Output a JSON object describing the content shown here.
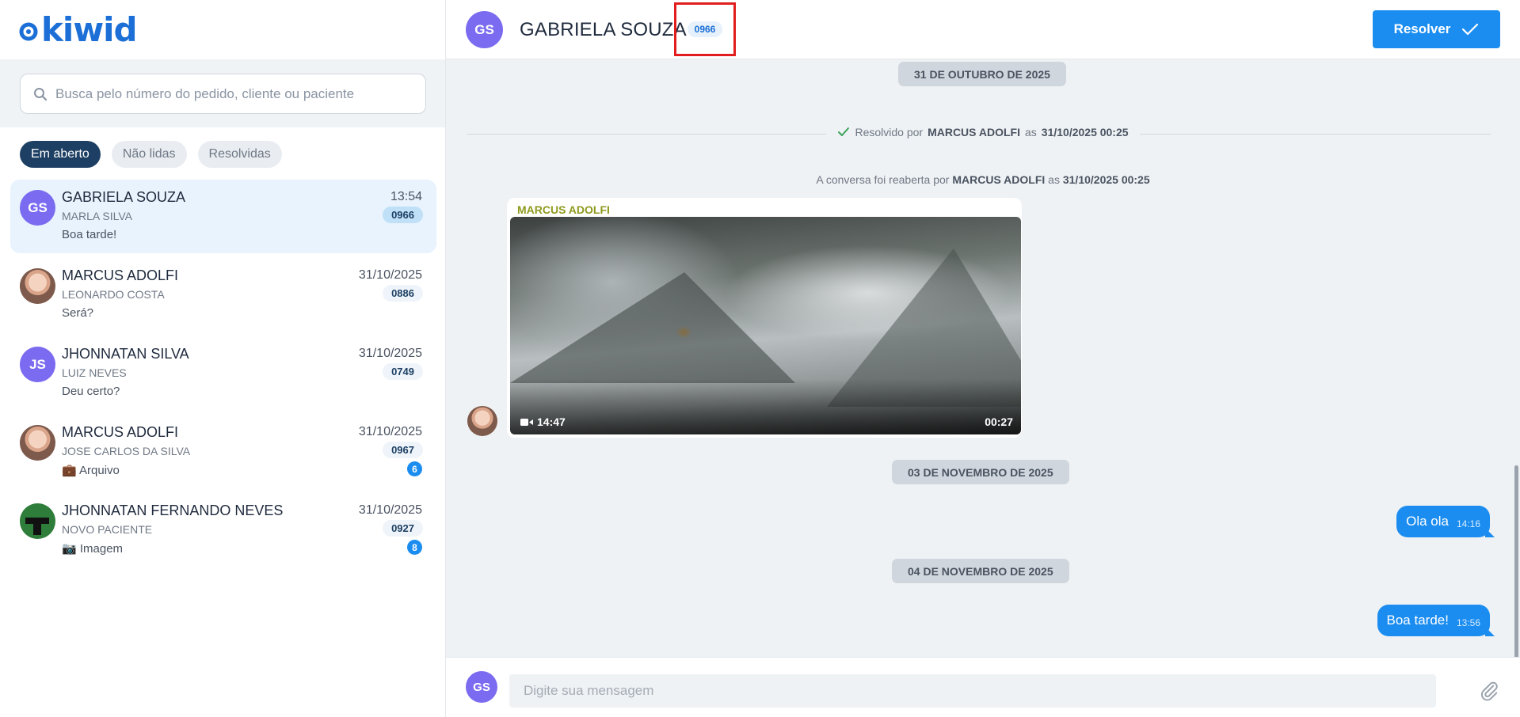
{
  "brand": {
    "logo_text": "kiwid"
  },
  "search": {
    "placeholder": "Busca pelo número do pedido, cliente ou paciente",
    "icon": "search-icon"
  },
  "filters": [
    {
      "label": "Em aberto",
      "active": true
    },
    {
      "label": "Não lidas",
      "active": false
    },
    {
      "label": "Resolvidas",
      "active": false
    }
  ],
  "conversations": [
    {
      "initials": "GS",
      "avatar": "initials",
      "name": "GABRIELA SOUZA",
      "patient": "MARLA SILVA",
      "last_message": "Boa tarde!",
      "time": "13:54",
      "order": "0966",
      "unread": "",
      "selected": true
    },
    {
      "initials": "",
      "avatar": "photo",
      "name": "MARCUS ADOLFI",
      "patient": "LEONARDO COSTA",
      "last_message": "Será?",
      "time": "31/10/2025",
      "order": "0886",
      "unread": ""
    },
    {
      "initials": "JS",
      "avatar": "initials",
      "name": "JHONNATAN SILVA",
      "patient": "LUIZ NEVES",
      "last_message": "Deu certo?",
      "time": "31/10/2025",
      "order": "0749",
      "unread": ""
    },
    {
      "initials": "",
      "avatar": "photo",
      "name": "MARCUS ADOLFI",
      "patient": "JOSE CARLOS DA SILVA",
      "last_message": "💼 Arquivo",
      "time": "31/10/2025",
      "order": "0967",
      "unread": "6"
    },
    {
      "initials": "",
      "avatar": "green",
      "name": "JHONNATAN FERNANDO NEVES",
      "patient": "NOVO PACIENTE",
      "last_message": "📷 Imagem",
      "time": "31/10/2025",
      "order": "0927",
      "unread": "8"
    }
  ],
  "chat": {
    "header": {
      "initials": "GS",
      "name": "GABRIELA SOUZA",
      "order_badge": "0966",
      "resolve_label": "Resolver"
    },
    "date_1": "31 DE OUTUBRO DE 2025",
    "resolved_prefix": "Resolvido por",
    "resolved_by": "MARCUS ADOLFI",
    "resolved_mid": "as",
    "resolved_at": "31/10/2025 00:25",
    "reopened_prefix": "A conversa foi reaberta por",
    "reopened_by": "MARCUS ADOLFI",
    "reopened_mid": "as",
    "reopened_at": "31/10/2025 00:25",
    "video_message": {
      "sender": "MARCUS ADOLFI",
      "time": "14:47",
      "duration": "00:27",
      "icon": "video-camera-icon"
    },
    "date_2": "03 DE NOVEMBRO DE 2025",
    "outgoing_1": {
      "text": "Ola ola",
      "time": "14:16"
    },
    "date_3": "04 DE NOVEMBRO DE 2025",
    "outgoing_2": {
      "text": "Boa tarde!",
      "time": "13:56"
    },
    "composer": {
      "initials": "GS",
      "placeholder": "Digite sua mensagem",
      "attach_icon": "paperclip-icon"
    }
  },
  "colors": {
    "accent": "#1b8df0",
    "active_chip": "#1d3f63",
    "highlight": "#e11d1d",
    "sender_name": "#8e9a1c"
  }
}
